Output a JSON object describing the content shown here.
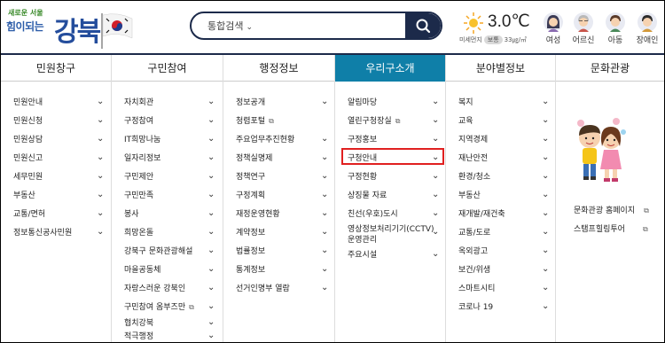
{
  "header": {
    "logo": {
      "tagline": "새로운 서울",
      "slogan": "힘이되는",
      "name": "강북"
    },
    "search": {
      "selector_label": "통합검색"
    },
    "weather": {
      "temperature": "3.0℃",
      "dust_label": "미세먼지",
      "dust_status": "보통",
      "dust_value": "33㎍/㎥"
    },
    "people": [
      {
        "label": "여성",
        "icon": "woman-icon"
      },
      {
        "label": "어르신",
        "icon": "elder-icon"
      },
      {
        "label": "아동",
        "icon": "child-icon"
      },
      {
        "label": "장애인",
        "icon": "disabled-icon"
      }
    ]
  },
  "nav": {
    "tabs": [
      "민원창구",
      "구민참여",
      "행정정보",
      "우리구소개",
      "분야별정보",
      "문화관광"
    ],
    "active_tab": "우리구소개"
  },
  "columns": {
    "civil": [
      "민원안내",
      "민원신청",
      "민원상담",
      "민원신고",
      "세무민원",
      "부동산",
      "교통/면허",
      "정보통신공사민원"
    ],
    "participation": [
      "자치회관",
      "구정참여",
      "IT희망나눔",
      "일자리정보",
      "구민제안",
      "구민만족",
      "봉사",
      "희망온돌",
      "강북구 문화관광해설",
      "마을공동체",
      "자랑스러운 강북인",
      "구민참여 옴부즈만",
      "협치강북",
      "적극행정"
    ],
    "admin": [
      "정보공개",
      "청렴포털",
      "주요업무추진현황",
      "정책실명제",
      "정책연구",
      "구정계획",
      "재정운영현황",
      "계약정보",
      "법률정보",
      "통계정보",
      "선거인명부 열람"
    ],
    "intro": [
      "알림마당",
      "열린구청장실",
      "구정홍보",
      "구청안내",
      "구정현황",
      "상징물 자료",
      "친선(우호)도시",
      "영상정보처리기기(CCTV)",
      "운영관리",
      "주요시설"
    ],
    "fields": [
      "복지",
      "교육",
      "지역경제",
      "재난안전",
      "환경/청소",
      "부동산",
      "재개발/재건축",
      "교통/도로",
      "옥외광고",
      "보건/위생",
      "스마트시티",
      "코로나 19"
    ],
    "culture": [
      "문화관광 홈페이지",
      "스탬프힐링투어"
    ]
  },
  "colors": {
    "navy": "#1c2a4a",
    "active_tab": "#0f7fa8",
    "highlight": "#e02020"
  }
}
